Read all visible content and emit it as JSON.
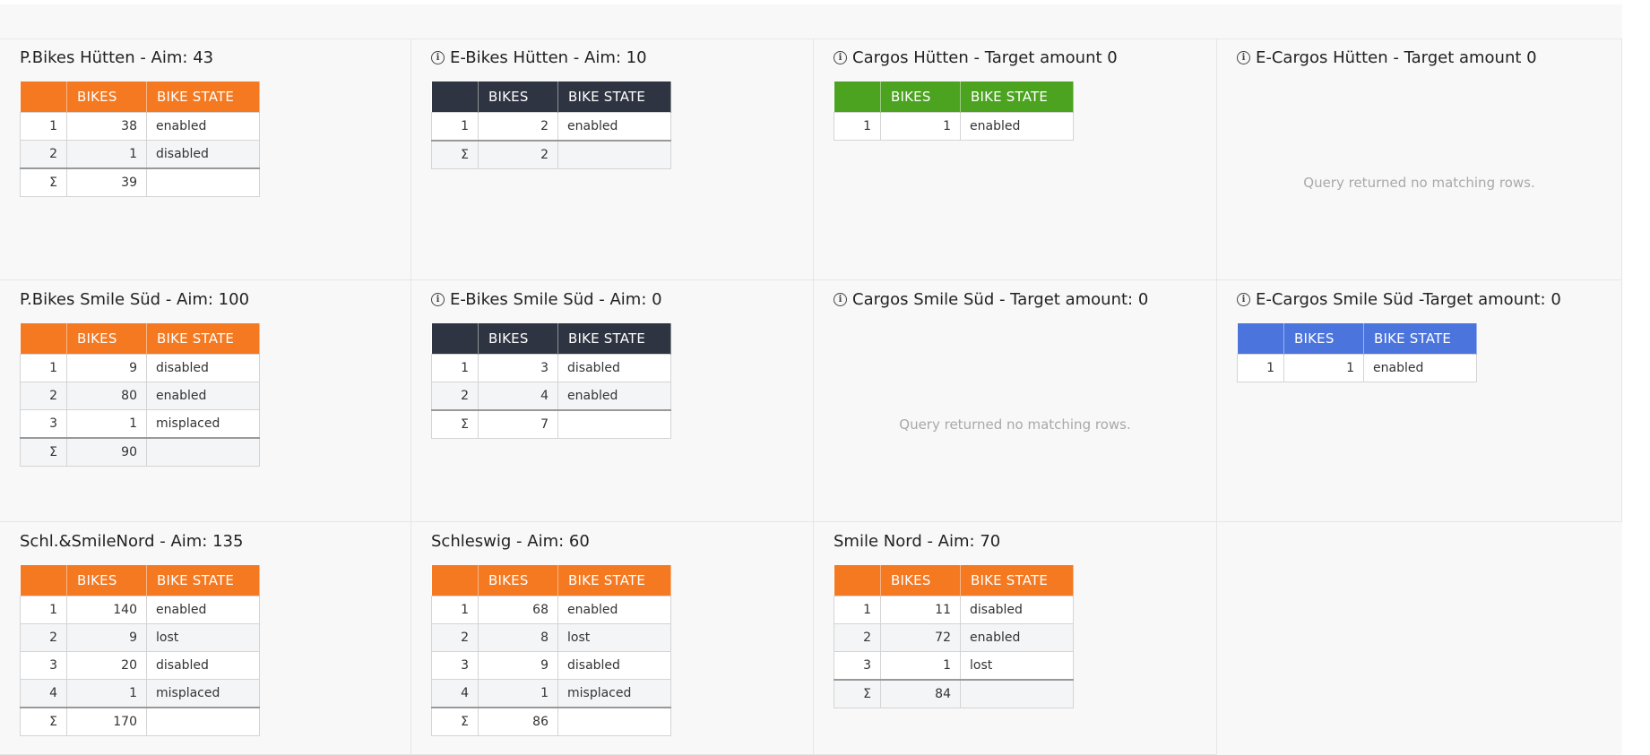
{
  "columns": {
    "idx": "",
    "bikes": "BIKES",
    "state": "BIKE STATE"
  },
  "sum_symbol": "Σ",
  "empty_message": "Query returned no matching rows.",
  "colors": {
    "orange": "#f47921",
    "navy": "#2e3441",
    "green": "#4ba31f",
    "blue": "#4b74dc"
  },
  "panels": [
    {
      "title": "P.Bikes Hütten - Aim: 43",
      "info": false,
      "color": "orange",
      "rows": [
        [
          "1",
          "38",
          "enabled"
        ],
        [
          "2",
          "1",
          "disabled"
        ]
      ],
      "sum": "39"
    },
    {
      "title": "E-Bikes Hütten - Aim: 10",
      "info": true,
      "color": "navy",
      "rows": [
        [
          "1",
          "2",
          "enabled"
        ]
      ],
      "sum": "2"
    },
    {
      "title": "Cargos Hütten - Target amount 0",
      "info": true,
      "color": "green",
      "rows": [
        [
          "1",
          "1",
          "enabled"
        ]
      ],
      "sum": null
    },
    {
      "title": "E-Cargos Hütten - Target amount 0",
      "info": true,
      "color": "blue",
      "rows": [],
      "sum": null
    },
    {
      "title": "P.Bikes Smile Süd - Aim: 100",
      "info": false,
      "color": "orange",
      "rows": [
        [
          "1",
          "9",
          "disabled"
        ],
        [
          "2",
          "80",
          "enabled"
        ],
        [
          "3",
          "1",
          "misplaced"
        ]
      ],
      "sum": "90"
    },
    {
      "title": "E-Bikes Smile Süd - Aim: 0",
      "info": true,
      "color": "navy",
      "rows": [
        [
          "1",
          "3",
          "disabled"
        ],
        [
          "2",
          "4",
          "enabled"
        ]
      ],
      "sum": "7"
    },
    {
      "title": "Cargos Smile Süd - Target amount: 0",
      "info": true,
      "color": "green",
      "rows": [],
      "sum": null
    },
    {
      "title": "E-Cargos Smile Süd -Target amount: 0",
      "info": true,
      "color": "blue",
      "rows": [
        [
          "1",
          "1",
          "enabled"
        ]
      ],
      "sum": null
    },
    {
      "title": "Schl.&SmileNord - Aim: 135",
      "info": false,
      "color": "orange",
      "rows": [
        [
          "1",
          "140",
          "enabled"
        ],
        [
          "2",
          "9",
          "lost"
        ],
        [
          "3",
          "20",
          "disabled"
        ],
        [
          "4",
          "1",
          "misplaced"
        ]
      ],
      "sum": "170"
    },
    {
      "title": "Schleswig - Aim: 60",
      "info": false,
      "color": "orange",
      "rows": [
        [
          "1",
          "68",
          "enabled"
        ],
        [
          "2",
          "8",
          "lost"
        ],
        [
          "3",
          "9",
          "disabled"
        ],
        [
          "4",
          "1",
          "misplaced"
        ]
      ],
      "sum": "86"
    },
    {
      "title": "Smile Nord - Aim: 70",
      "info": false,
      "color": "orange",
      "rows": [
        [
          "1",
          "11",
          "disabled"
        ],
        [
          "2",
          "72",
          "enabled"
        ],
        [
          "3",
          "1",
          "lost"
        ]
      ],
      "sum": "84"
    }
  ]
}
